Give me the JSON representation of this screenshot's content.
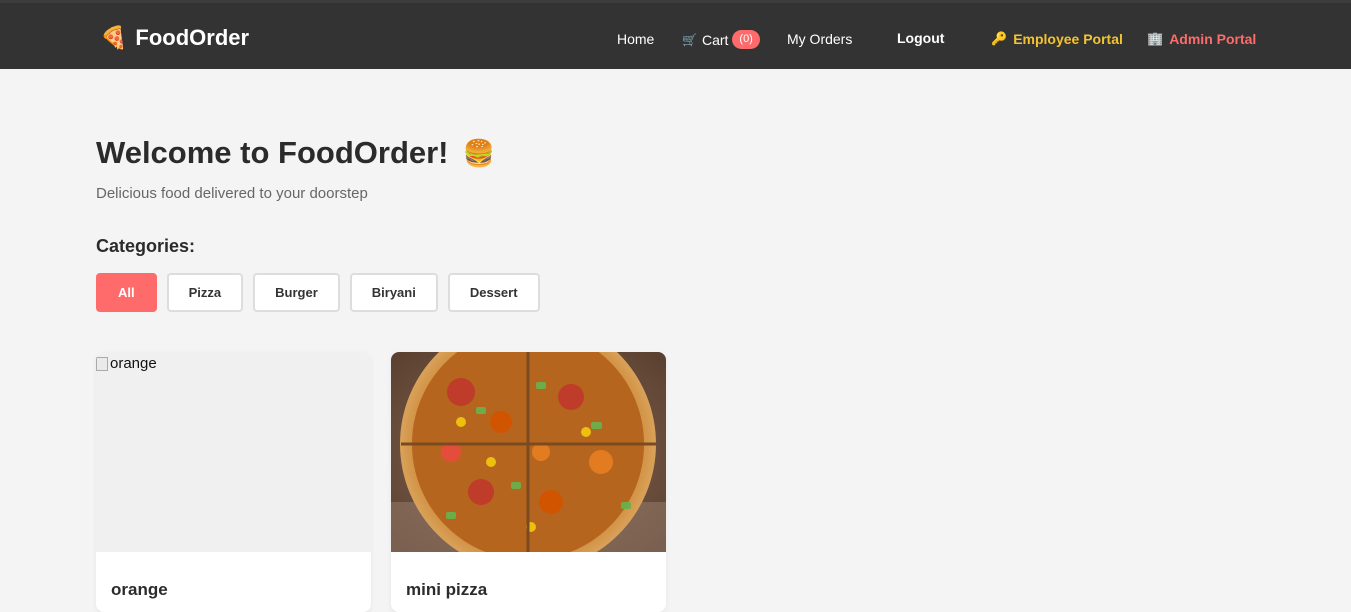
{
  "brand": {
    "name": "FoodOrder",
    "logo_icon": "pizza-icon"
  },
  "nav": {
    "home": "Home",
    "cart": "Cart",
    "cart_count": "(0)",
    "my_orders": "My Orders",
    "logout": "Logout",
    "employee_portal": "Employee Portal",
    "admin_portal": "Admin Portal"
  },
  "hero": {
    "title": "Welcome to FoodOrder!",
    "title_icon": "burger-icon",
    "subtitle": "Delicious food delivered to your doorstep"
  },
  "categories": {
    "heading": "Categories:",
    "items": [
      "All",
      "Pizza",
      "Burger",
      "Biryani",
      "Dessert"
    ],
    "active": "All"
  },
  "products": [
    {
      "name": "orange",
      "image_alt": "orange",
      "image_loaded": false
    },
    {
      "name": "mini pizza",
      "image_alt": "mini pizza",
      "image_loaded": true
    }
  ],
  "colors": {
    "navbar": "#333333",
    "accent": "#ff6b6b",
    "employee_link": "#f4c430",
    "page_bg": "#f4f4f4"
  }
}
